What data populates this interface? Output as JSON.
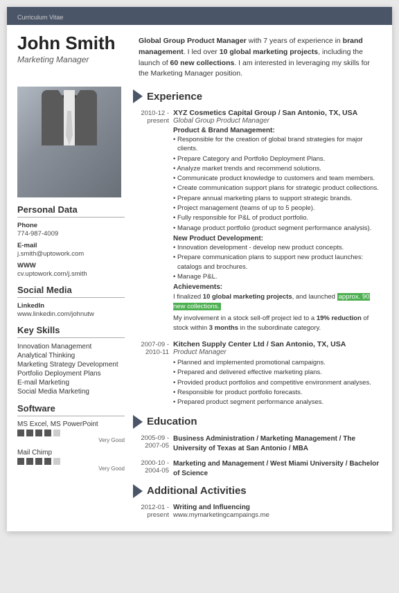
{
  "header": {
    "cv_label": "Curriculum Vitae"
  },
  "name": "John Smith",
  "job_title": "Marketing Manager",
  "summary": "Global Group Product Manager with 7 years of experience in brand management. I led over 10 global marketing projects, including the launch of 60 new collections. I am interested in leveraging my skills for the Marketing Manager position.",
  "personal_data": {
    "section_title": "Personal Data",
    "phone_label": "Phone",
    "phone": "774-987-4009",
    "email_label": "E-mail",
    "email": "j.smith@uptowork.com",
    "www_label": "WWW",
    "www": "cv.uptowork.com/j.smith"
  },
  "social_media": {
    "section_title": "Social Media",
    "linkedin_label": "LinkedIn",
    "linkedin": "www.linkedin.com/johnutw"
  },
  "key_skills": {
    "section_title": "Key Skills",
    "items": [
      "Innovation Management",
      "Analytical Thinking",
      "Marketing Strategy Development",
      "Portfolio Deployment Plans",
      "E-mail Marketing",
      "Social Media Marketing"
    ]
  },
  "software": {
    "section_title": "Software",
    "items": [
      {
        "name": "MS Excel, MS PowerPoint",
        "level": 4,
        "max": 5,
        "label": "Very Good"
      },
      {
        "name": "Mail Chimp",
        "level": 4,
        "max": 5,
        "label": "Very Good"
      }
    ]
  },
  "experience": {
    "section_title": "Experience",
    "entries": [
      {
        "date": "2010-12 - present",
        "company": "XYZ Cosmetics Capital Group / San Antonio, TX, USA",
        "role": "Global Group Product Manager",
        "sections": [
          {
            "heading": "Product & Brand Management:",
            "bullets": [
              "Responsible for the creation of global brand strategies for major clients.",
              "Prepare Category and Portfolio Deployment Plans.",
              "Analyze market trends and recommend solutions.",
              "Communicate product knowledge to customers and team members.",
              "Create communication support plans for strategic product collections.",
              "Prepare annual marketing plans to support strategic brands.",
              "Project management (teams of up to 5 people).",
              "Fully responsible for P&L of product portfolio.",
              "Manage product portfolio (product segment performance analysis)."
            ]
          },
          {
            "heading": "New Product Development:",
            "bullets": [
              "Innovation development - develop new product concepts.",
              "Prepare communication plans to support new product launches: catalogs and brochures.",
              "Manage P&L."
            ]
          }
        ],
        "achievements_heading": "Achievements:",
        "achievement_text": "I finalized 10 global marketing projects, and launched approx. 90 new collections.",
        "achievement_text2": "My involvement in a stock sell-off project led to a 19% reduction of stock within 3 months in the subordinate category."
      },
      {
        "date": "2007-09 - 2010-11",
        "company": "Kitchen Supply Center Ltd / San Antonio, TX, USA",
        "role": "Product Manager",
        "sections": [
          {
            "heading": "",
            "bullets": [
              "Planned and implemented promotional campaigns.",
              "Prepared and delivered effective marketing plans.",
              "Provided product portfolios and competitive environment analyses.",
              "Responsible for product portfolio forecasts.",
              "Prepared product segment performance analyses."
            ]
          }
        ]
      }
    ]
  },
  "education": {
    "section_title": "Education",
    "entries": [
      {
        "date": "2005-09 - 2007-05",
        "degree": "Business Administration / Marketing Management / The University of Texas at San Antonio / MBA"
      },
      {
        "date": "2000-10 - 2004-05",
        "degree": "Marketing and Management / West Miami University / Bachelor of Science"
      }
    ]
  },
  "additional_activities": {
    "section_title": "Additional Activities",
    "entries": [
      {
        "date": "2012-01 - present",
        "title": "Writing and Influencing",
        "value": "www.mymarketingcampaings.me"
      }
    ]
  }
}
